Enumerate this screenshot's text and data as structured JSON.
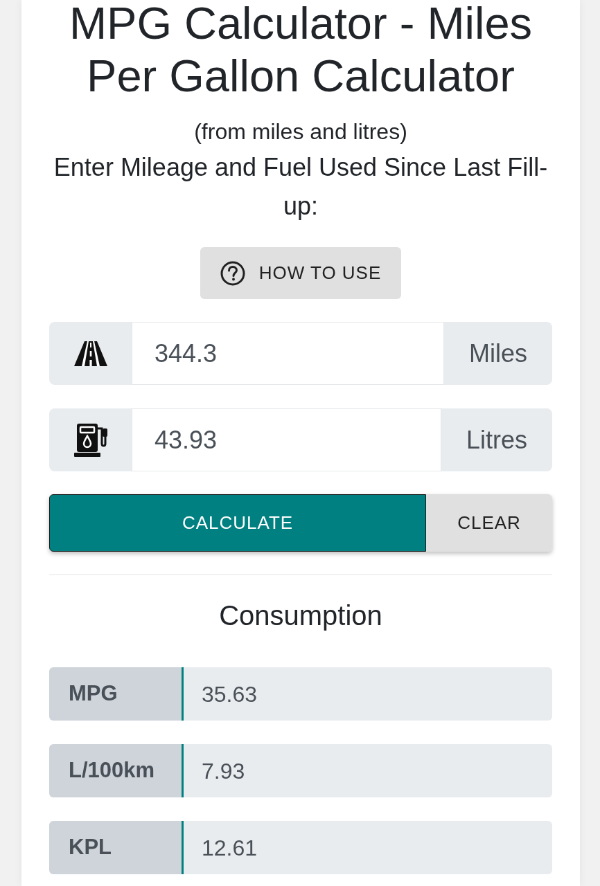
{
  "title": "MPG Calculator - Miles Per Gallon Calculator",
  "subtitle": "(from miles and litres)",
  "instructions": "Enter Mileage and Fuel Used Since Last Fill-up:",
  "help_button": {
    "label": "HOW TO USE"
  },
  "inputs": [
    {
      "kind": "distance",
      "value": "344.3",
      "unit": "Miles"
    },
    {
      "kind": "fuel",
      "value": "43.93",
      "unit": "Litres"
    }
  ],
  "actions": [
    {
      "kind": "primary",
      "label": "CALCULATE"
    },
    {
      "kind": "secondary",
      "label": "CLEAR"
    }
  ],
  "results": {
    "heading": "Consumption",
    "rows": [
      {
        "label": "MPG",
        "value": "35.63"
      },
      {
        "label": "L/100km",
        "value": "7.93"
      },
      {
        "label": "KPL",
        "value": "12.61"
      }
    ]
  }
}
